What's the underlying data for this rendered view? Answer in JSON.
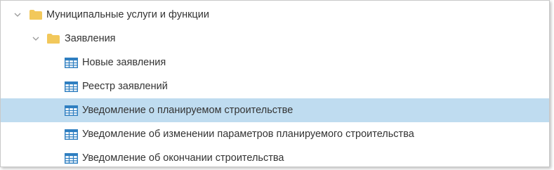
{
  "tree": {
    "root": {
      "label": "Муниципальные услуги и функции",
      "expanded": true,
      "icon": "folder-icon",
      "child": {
        "label": "Заявления",
        "expanded": true,
        "icon": "folder-icon",
        "items": [
          {
            "label": "Новые заявления",
            "icon": "table-icon",
            "selected": false
          },
          {
            "label": "Реестр заявлений",
            "icon": "table-icon",
            "selected": false
          },
          {
            "label": "Уведомление о планируемом строительстве",
            "icon": "table-icon",
            "selected": true
          },
          {
            "label": "Уведомление об изменении параметров планируемого строительства",
            "icon": "table-icon",
            "selected": false
          },
          {
            "label": "Уведомление об окончании строительства",
            "icon": "table-icon",
            "selected": false
          }
        ]
      }
    }
  },
  "colors": {
    "selected_row": "#bfdcf0",
    "folder": "#f2c85b",
    "table_icon": "#2f7fc1",
    "chevron": "#9a9a9a",
    "text": "#333333"
  }
}
